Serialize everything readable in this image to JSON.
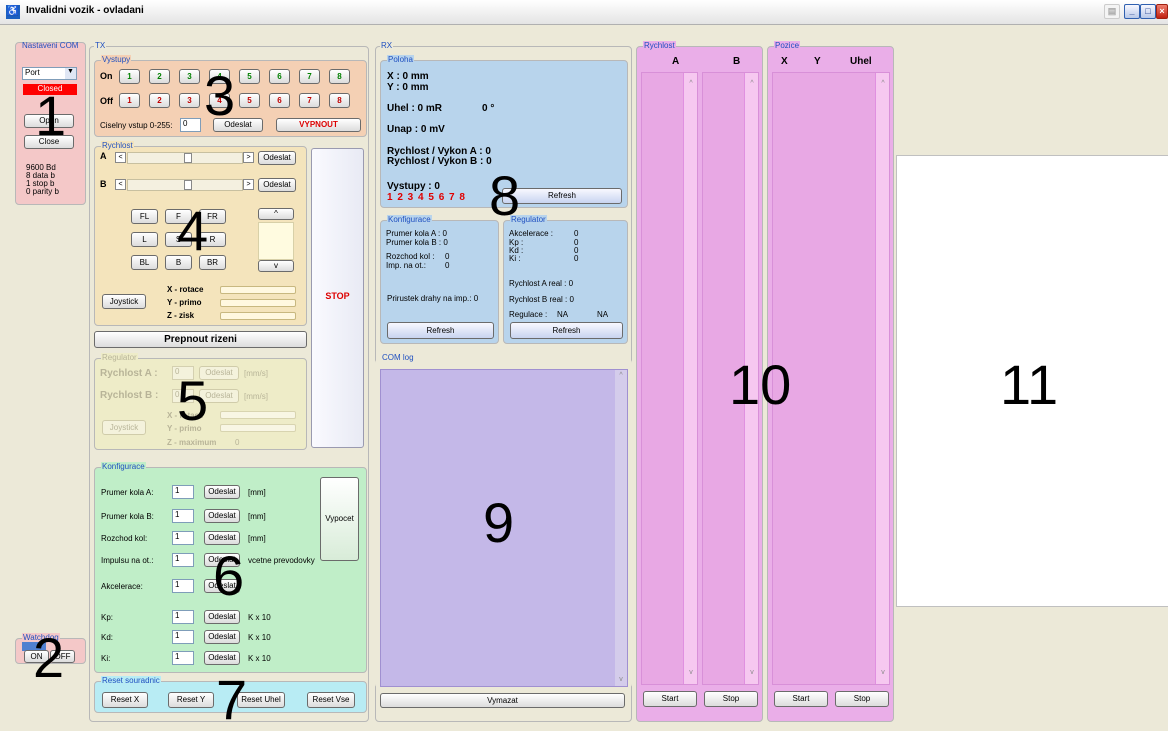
{
  "window": {
    "title": "Invalidni vozik - ovladani"
  },
  "com": {
    "group": "Nastaveni COM",
    "port": "Port",
    "status": "Closed",
    "open": "Open",
    "close": "Close",
    "info": [
      "9600 Bd",
      "8 data b",
      "1 stop b",
      "0 parity b"
    ]
  },
  "watchdog": {
    "group": "Watchdog",
    "on": "ON",
    "off": "OFF"
  },
  "tx": {
    "group": "TX"
  },
  "vystupy": {
    "group": "Vystupy",
    "on": "On",
    "off": "Off",
    "nums": [
      "1",
      "2",
      "3",
      "4",
      "5",
      "6",
      "7",
      "8"
    ],
    "ciselny": "Ciselny vstup 0-255:",
    "ciselny_val": "0",
    "odeslat": "Odeslat",
    "vypnout": "VYPNOUT"
  },
  "rychlost": {
    "group": "Rychlost",
    "a": "A",
    "b": "B",
    "odeslat": "Odeslat",
    "dir": [
      "FL",
      "F",
      "FR",
      "L",
      "S",
      "R",
      "BL",
      "B",
      "BR"
    ],
    "up": "^",
    "down": "v",
    "joystick": "Joystick",
    "x": "X - rotace",
    "y": "Y - primo",
    "z": "Z - zisk",
    "stop": "STOP",
    "prepnout": "Prepnout rizeni"
  },
  "regulator": {
    "group": "Regulator",
    "ra": "Rychlost A :",
    "rb": "Rychlost B :",
    "val": "0",
    "odeslat": "Odeslat",
    "unit": "[mm/s]",
    "joystick": "Joystick",
    "x": "X - rotace",
    "y": "Y - primo",
    "z": "Z - maximum",
    "zval": "0"
  },
  "konfig": {
    "group": "Konfigurace",
    "rows": [
      {
        "l": "Prumer kola A:",
        "v": "1",
        "u": "[mm]"
      },
      {
        "l": "Prumer kola B:",
        "v": "1",
        "u": "[mm]"
      },
      {
        "l": "Rozchod kol:",
        "v": "1",
        "u": "[mm]"
      },
      {
        "l": "Impulsu na ot.:",
        "v": "1",
        "u": "vcetne prevodovky"
      },
      {
        "l": "Akcelerace:",
        "v": "1",
        "u": ""
      },
      {
        "l": "Kp:",
        "v": "1",
        "u": "K x 10"
      },
      {
        "l": "Kd:",
        "v": "1",
        "u": "K x 10"
      },
      {
        "l": "Ki:",
        "v": "1",
        "u": "K x 10"
      }
    ],
    "odeslat": "Odeslat",
    "vypocet": "Vypocet"
  },
  "reset": {
    "group": "Reset souradnic",
    "x": "Reset X",
    "y": "Reset Y",
    "uhel": "Reset Uhel",
    "vse": "Reset Vse"
  },
  "rx": {
    "group": "RX",
    "poloha": "Poloha",
    "x": "X :  0 mm",
    "y": "Y :  0 mm",
    "uhel": "Uhel :  0 mR",
    "deg": "0 °",
    "unap": "Unap :  0 mV",
    "rva": "Rychlost / Vykon A :  0",
    "rvb": "Rychlost / Vykon B :  0",
    "vyst": "Vystupy :  0",
    "vystnums": "1 2 3 4 5 6 7 8",
    "refresh": "Refresh"
  },
  "rxkonf": {
    "group": "Konfigurace",
    "pa": "Prumer kola A :  0",
    "pb": "Prumer kola B :  0",
    "roz": "Rozchod kol :",
    "imp": "Imp. na ot.:",
    "z": "0",
    "prir": "Prirustek drahy na imp.:  0",
    "refresh": "Refresh"
  },
  "rxreg": {
    "group": "Regulator",
    "ak": "Akcelerace :",
    "kp": "Kp :",
    "kd": "Kd :",
    "ki": "Ki :",
    "z": "0",
    "ra": "Rychlost A real :  0",
    "rb": "Rychlost B real :  0",
    "reg": "Regulace :",
    "na1": "NA",
    "na2": "NA",
    "refresh": "Refresh"
  },
  "comlog": {
    "group": "COM log",
    "vymazat": "Vymazat"
  },
  "graf_rychlost": {
    "group": "Rychlost",
    "a": "A",
    "b": "B",
    "start": "Start",
    "stop": "Stop"
  },
  "graf_pozice": {
    "group": "Pozice",
    "x": "X",
    "y": "Y",
    "uhel": "Uhel",
    "start": "Start",
    "stop": "Stop"
  },
  "markers": [
    "1",
    "2",
    "3",
    "4",
    "5",
    "6",
    "7",
    "8",
    "9",
    "10",
    "11"
  ]
}
